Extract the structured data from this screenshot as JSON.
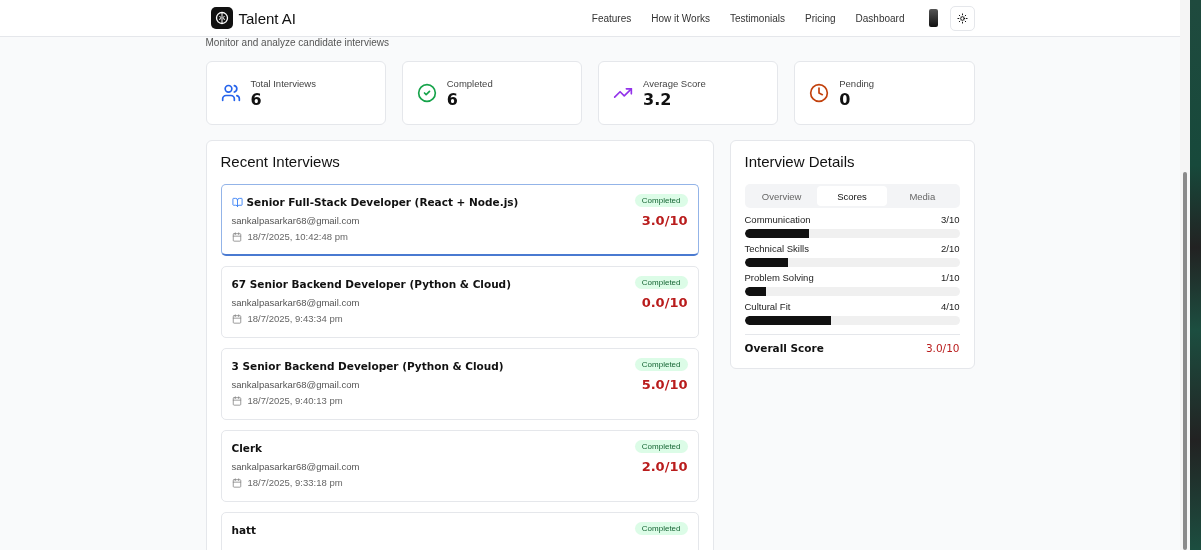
{
  "brand": {
    "name": "Talent AI"
  },
  "nav": {
    "links": [
      "Features",
      "How it Works",
      "Testimonials",
      "Pricing",
      "Dashboard"
    ]
  },
  "page": {
    "subtitle": "Monitor and analyze candidate interviews"
  },
  "stats": [
    {
      "kind": "users",
      "label": "Total Interviews",
      "value": "6"
    },
    {
      "kind": "check",
      "label": "Completed",
      "value": "6"
    },
    {
      "kind": "trend",
      "label": "Average Score",
      "value": "3.2"
    },
    {
      "kind": "clock",
      "label": "Pending",
      "value": "0"
    }
  ],
  "recent": {
    "title": "Recent Interviews",
    "items": [
      {
        "title": "Senior Full-Stack Developer (React + Node.js)",
        "book_icon": true,
        "email": "sankalpasarkar68@gmail.com",
        "date": "18/7/2025, 10:42:48 pm",
        "status": "Completed",
        "score": "3.0/10",
        "selected": true
      },
      {
        "title": "67 Senior Backend Developer (Python & Cloud)",
        "book_icon": false,
        "email": "sankalpasarkar68@gmail.com",
        "date": "18/7/2025, 9:43:34 pm",
        "status": "Completed",
        "score": "0.0/10",
        "selected": false
      },
      {
        "title": "3 Senior Backend Developer (Python & Cloud)",
        "book_icon": false,
        "email": "sankalpasarkar68@gmail.com",
        "date": "18/7/2025, 9:40:13 pm",
        "status": "Completed",
        "score": "5.0/10",
        "selected": false
      },
      {
        "title": "Clerk",
        "book_icon": false,
        "email": "sankalpasarkar68@gmail.com",
        "date": "18/7/2025, 9:33:18 pm",
        "status": "Completed",
        "score": "2.0/10",
        "selected": false
      },
      {
        "title": "hatt",
        "book_icon": false,
        "status": "Completed",
        "selected": false
      }
    ]
  },
  "details": {
    "title": "Interview Details",
    "tabs": [
      {
        "label": "Overview",
        "selected": false
      },
      {
        "label": "Scores",
        "selected": true
      },
      {
        "label": "Media",
        "selected": false
      }
    ],
    "scores": [
      {
        "name": "Communication",
        "reading": "3/10",
        "level": 0.3
      },
      {
        "name": "Technical Skills",
        "reading": "2/10",
        "level": 0.2
      },
      {
        "name": "Problem Solving",
        "reading": "1/10",
        "level": 0.1
      },
      {
        "name": "Cultural Fit",
        "reading": "4/10",
        "level": 0.4
      }
    ],
    "overall": {
      "label": "Overall Score",
      "value": "3.0/10"
    }
  }
}
